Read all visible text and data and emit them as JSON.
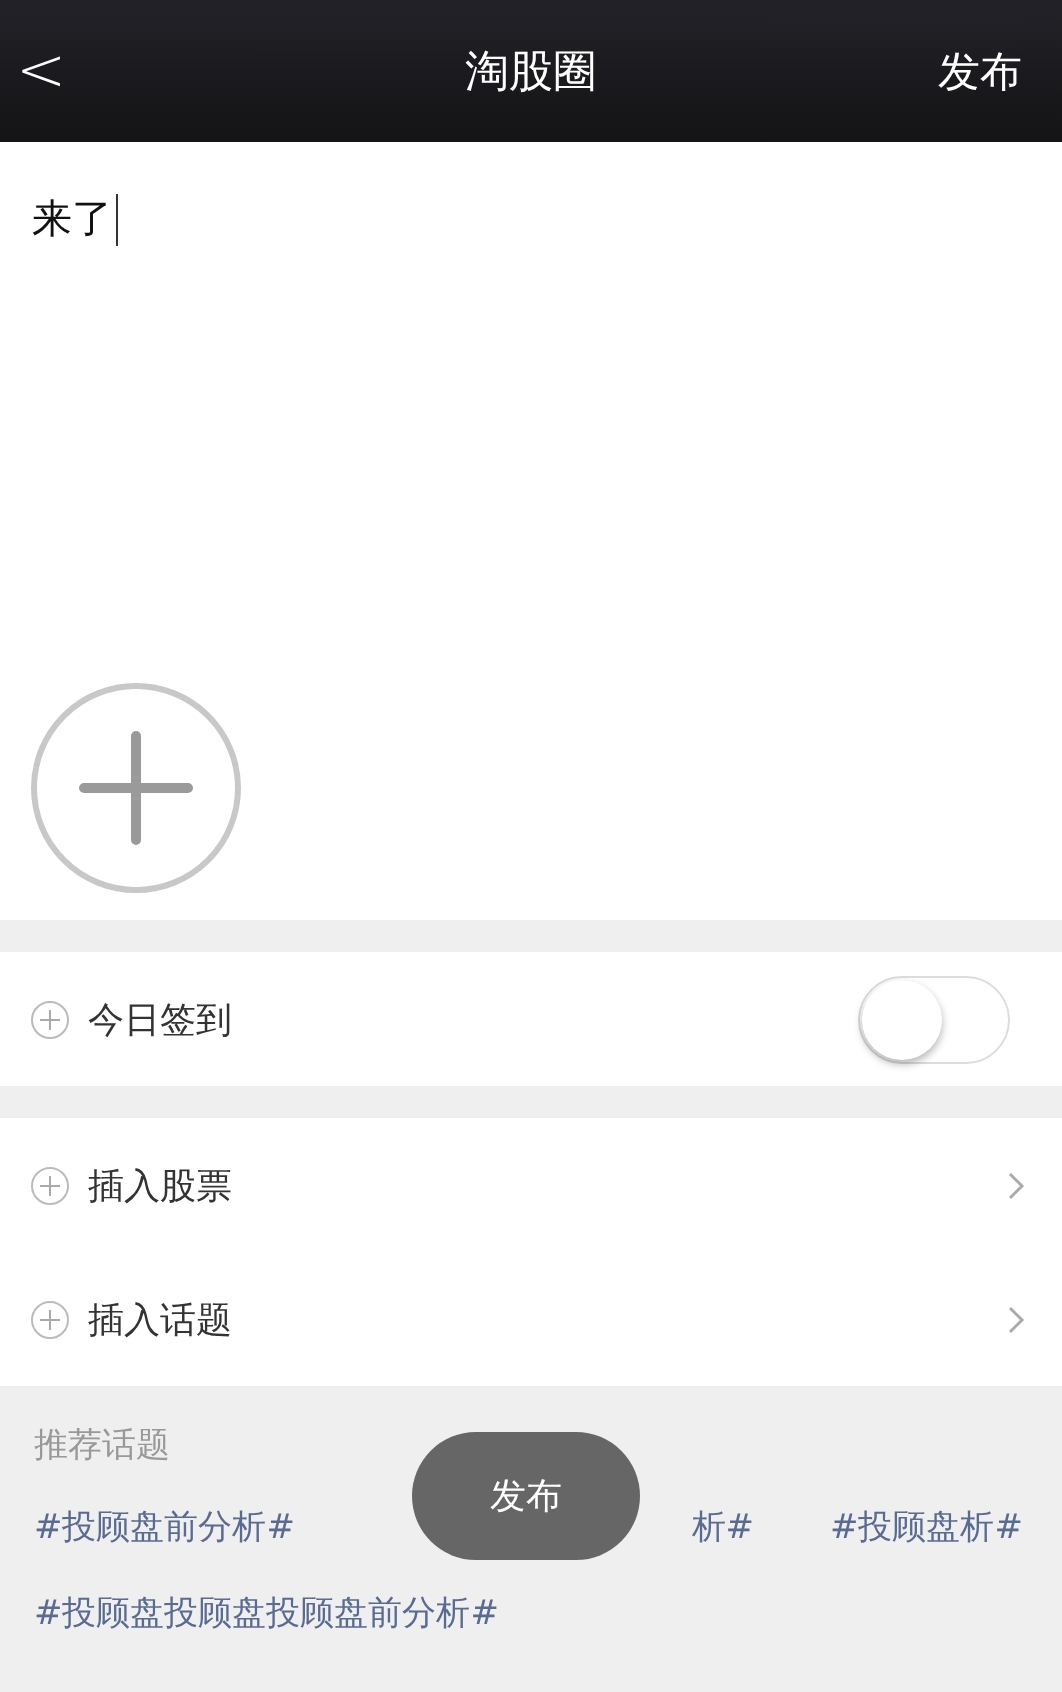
{
  "nav": {
    "back": "<",
    "title": "淘股圈",
    "action": "发布"
  },
  "editor": {
    "value": "来了",
    "cursor": true
  },
  "options": [
    {
      "kind": "toggle",
      "label": "今日签到",
      "checked": false
    },
    {
      "kind": "link",
      "label": "插入股票"
    },
    {
      "kind": "link",
      "label": "插入话题"
    }
  ],
  "recommended": {
    "title": "推荐话题",
    "topics": [
      "#投顾盘前分析#",
      "析#",
      "#投顾盘析#",
      "#投顾盘投顾盘投顾盘前分析#"
    ]
  },
  "toast": {
    "text": "发布"
  }
}
